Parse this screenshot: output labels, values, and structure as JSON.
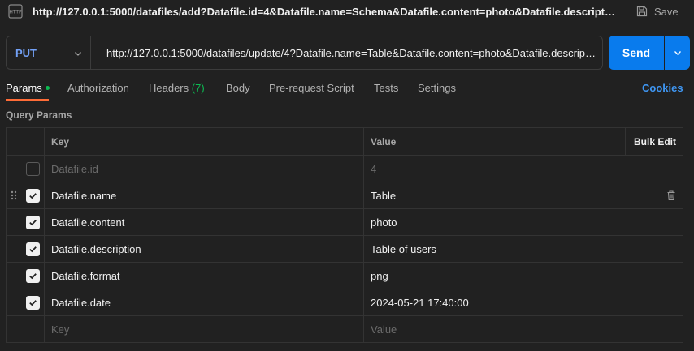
{
  "title_bar": {
    "icon": "http-icon",
    "title": "http://127.0.0.1:5000/datafiles/add?Datafile.id=4&Datafile.name=Schema&Datafile.content=photo&Datafile.description...",
    "save_label": "Save"
  },
  "request": {
    "method": "PUT",
    "url": "http://127.0.0.1:5000/datafiles/update/4?Datafile.name=Table&Datafile.content=photo&Datafile.descripti ...",
    "send_label": "Send"
  },
  "tabs": [
    {
      "label": "Params",
      "active": true,
      "dot": true
    },
    {
      "label": "Authorization"
    },
    {
      "label": "Headers",
      "count": "(7)"
    },
    {
      "label": "Body"
    },
    {
      "label": "Pre-request Script"
    },
    {
      "label": "Tests"
    },
    {
      "label": "Settings"
    }
  ],
  "cookies_label": "Cookies",
  "query_params": {
    "section_title": "Query Params",
    "headers": {
      "key": "Key",
      "value": "Value",
      "bulk_edit": "Bulk Edit"
    },
    "rows": [
      {
        "checked": false,
        "key": "Datafile.id",
        "value": "4",
        "disabled": true
      },
      {
        "checked": true,
        "key": "Datafile.name",
        "value": "Table",
        "hovered": true
      },
      {
        "checked": true,
        "key": "Datafile.content",
        "value": "photo"
      },
      {
        "checked": true,
        "key": "Datafile.description",
        "value": "Table of users"
      },
      {
        "checked": true,
        "key": "Datafile.format",
        "value": "png"
      },
      {
        "checked": true,
        "key": "Datafile.date",
        "value": "2024-05-21 17:40:00"
      }
    ],
    "placeholder": {
      "key": "Key",
      "value": "Value"
    }
  },
  "colors": {
    "accent_orange": "#ff6c37",
    "send_blue": "#097bed",
    "method_put": "#73a1f7",
    "status_green": "#0cbb52",
    "link_blue": "#3f97f4"
  }
}
